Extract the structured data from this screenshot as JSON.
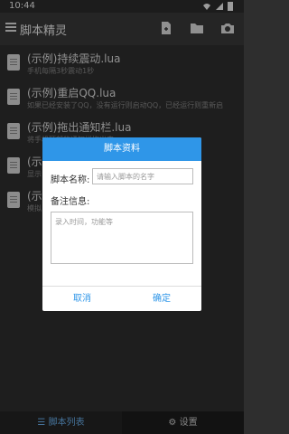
{
  "status": {
    "time": "10:44"
  },
  "appbar": {
    "title": "脚本精灵"
  },
  "list": [
    {
      "title": "(示例)持续震动.lua",
      "subtitle": "手机每隔3秒震动1秒"
    },
    {
      "title": "(示例)重启QQ.lua",
      "subtitle": "如果已经安装了QQ，没有运行则启动QQ，已经运行则重新启"
    },
    {
      "title": "(示例)拖出通知栏.lua",
      "subtitle": "将手机顶部的通知栏拖出来"
    },
    {
      "title": "(示",
      "subtitle": "显示"
    },
    {
      "title": "(示例",
      "subtitle": "模拟"
    }
  ],
  "dialog": {
    "title": "脚本资料",
    "name_label": "脚本名称:",
    "name_placeholder": "请输入脚本的名字",
    "note_label": "备注信息:",
    "note_placeholder": "录入时间，功能等",
    "cancel": "取消",
    "ok": "确定"
  },
  "tabs": {
    "list": "脚本列表",
    "settings": "设置"
  }
}
